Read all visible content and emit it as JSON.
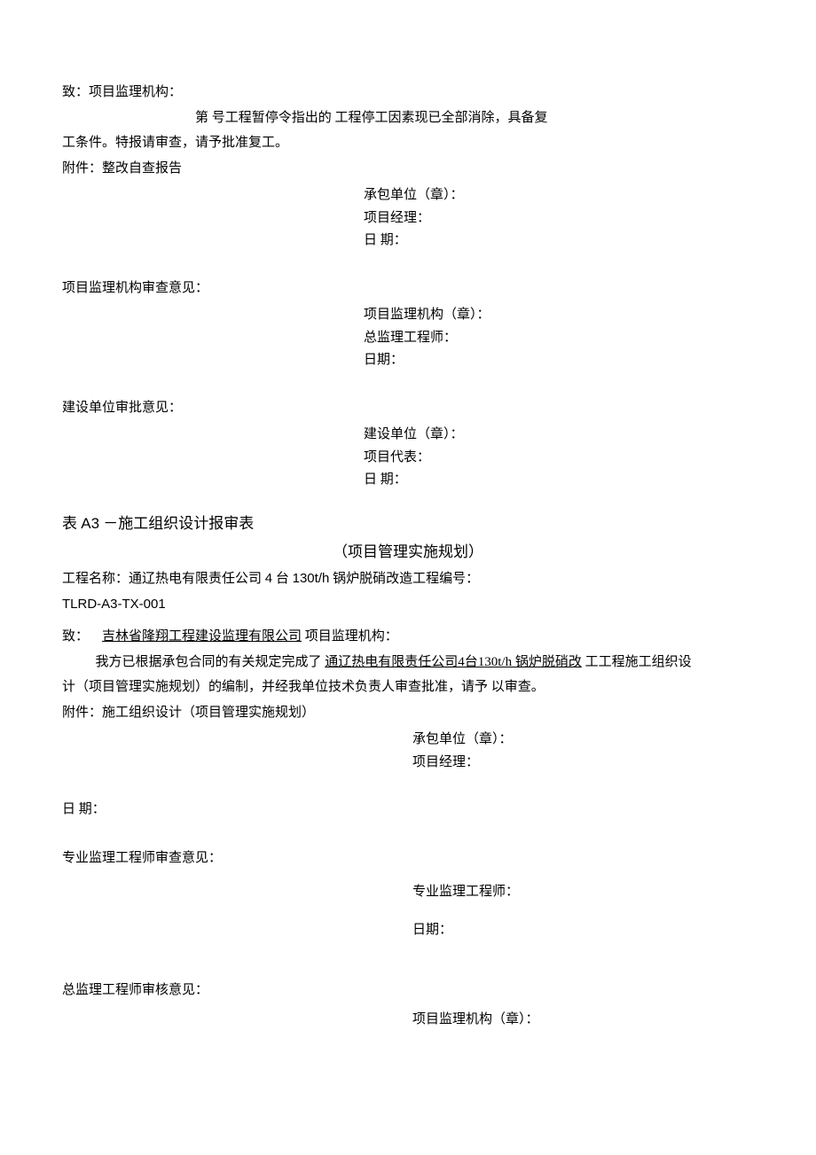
{
  "form1": {
    "to_label": "致：项目监理机构：",
    "body_line1_prefix": "第",
    "body_line1_mid": "号工程暂停令指出的",
    "body_line1_suffix": "工程停工因素现已全部消除，具备复",
    "body_line2": "工条件。特报请审查，请予批准复工。",
    "attachment": "附件：整改自查报告",
    "sig": {
      "contractor": "承包单位（章）：",
      "pm": "项目经理：",
      "date": "日  期："
    },
    "review_header": "项目监理机构审查意见：",
    "review_sig": {
      "org": "项目监理机构（章）：",
      "engineer": "总监理工程师：",
      "date": "日期："
    },
    "owner_header": "建设单位审批意见：",
    "owner_sig": {
      "org": "建设单位（章）：",
      "rep": "项目代表：",
      "date": "日  期："
    }
  },
  "form2": {
    "title_prefix": "表",
    "title_code": "A3",
    "title_suffix": "－施工组织设计报审表",
    "subtitle": "（项目管理实施规划）",
    "proj_label": "工程名称：通辽热电有限责任公司",
    "proj_mid_a": "4",
    "proj_mid_b": "台",
    "proj_mid_c": "130t/h",
    "proj_suffix": "锅炉脱硝改造工程编号：",
    "proj_code": "TLRD-A3-TX-001",
    "to_prefix": "致：",
    "to_underline": "吉林省隆翔工程建设监理有限公司",
    "to_suffix": "项目监理机构：",
    "body1_prefix": "我方已根据承包合同的有关规定完成了",
    "body1_underline": "通辽热电有限责任公司4台130t/h 锅炉脱硝改",
    "body1_suffix": "工工程施工组织设",
    "body2": "计（项目管理实施规划）的编制，并经我单位技术负责人审查批准，请予  以审查。",
    "attachment": "附件：施工组织设计（项目管理实施规划）",
    "sig": {
      "contractor": "承包单位（章）：",
      "pm": "项目经理："
    },
    "date_label": "日  期：",
    "pro_review_header": "专业监理工程师审查意见：",
    "pro_sig": {
      "engineer": "专业监理工程师：",
      "date": "日期："
    },
    "chief_review_header": "总监理工程师审核意见：",
    "chief_sig": {
      "org": "项目监理机构（章）："
    }
  }
}
